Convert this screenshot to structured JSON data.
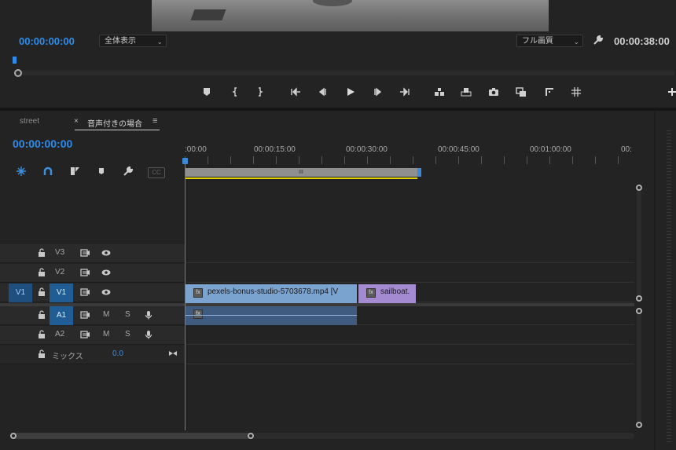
{
  "monitor": {
    "timecode_current": "00:00:00:00",
    "timecode_duration": "00:00:38:00",
    "fit_select": "全体表示",
    "quality_select": "フル画質",
    "controls": [
      "add-marker-icon",
      "mark-in-icon",
      "mark-out-icon",
      "go-to-in-icon",
      "step-back-icon",
      "play-icon",
      "step-forward-icon",
      "go-to-out-icon",
      "insert-icon",
      "overwrite-icon",
      "export-frame-icon",
      "comparison-view-icon",
      "trim-icon",
      "grid-icon",
      "add-button-icon"
    ]
  },
  "timeline": {
    "tabs": [
      {
        "label": "street",
        "active": false
      },
      {
        "label": "音声付きの場合",
        "active": true
      }
    ],
    "close_glyph": "×",
    "menu_glyph": "≡",
    "timecode": "00:00:00:00",
    "ruler_labels": [
      ":00:00",
      "00:00:15:00",
      "00:00:30:00",
      "00:00:45:00",
      "00:01:00:00",
      "00:"
    ],
    "tools": [
      "snap-icon",
      "linked-selection-icon",
      "insert-overwrite-icon",
      "add-marker-icon",
      "wrench-icon",
      "captions-icon"
    ],
    "tools_cc": "CC",
    "workbar_grip": "III",
    "video_tracks": [
      {
        "name": "V3"
      },
      {
        "name": "V2"
      },
      {
        "name": "V1",
        "source": "V1"
      }
    ],
    "audio_tracks": [
      {
        "name": "A1",
        "m": "M",
        "s": "S"
      },
      {
        "name": "A2",
        "m": "M",
        "s": "S"
      }
    ],
    "mix": {
      "label": "ミックス",
      "value": "0.0"
    },
    "clips": {
      "video1": "pexels-bonus-studio-5703678.mp4 [V",
      "video2": "sailboat.",
      "fx": "fx"
    }
  },
  "colors": {
    "accent": "#2d8ceb",
    "video_clip": "#7ba3cf",
    "video_clip2": "#a48bd1",
    "audio_clip": "#3f5b80",
    "workbar_yellow": "#e6d400"
  }
}
